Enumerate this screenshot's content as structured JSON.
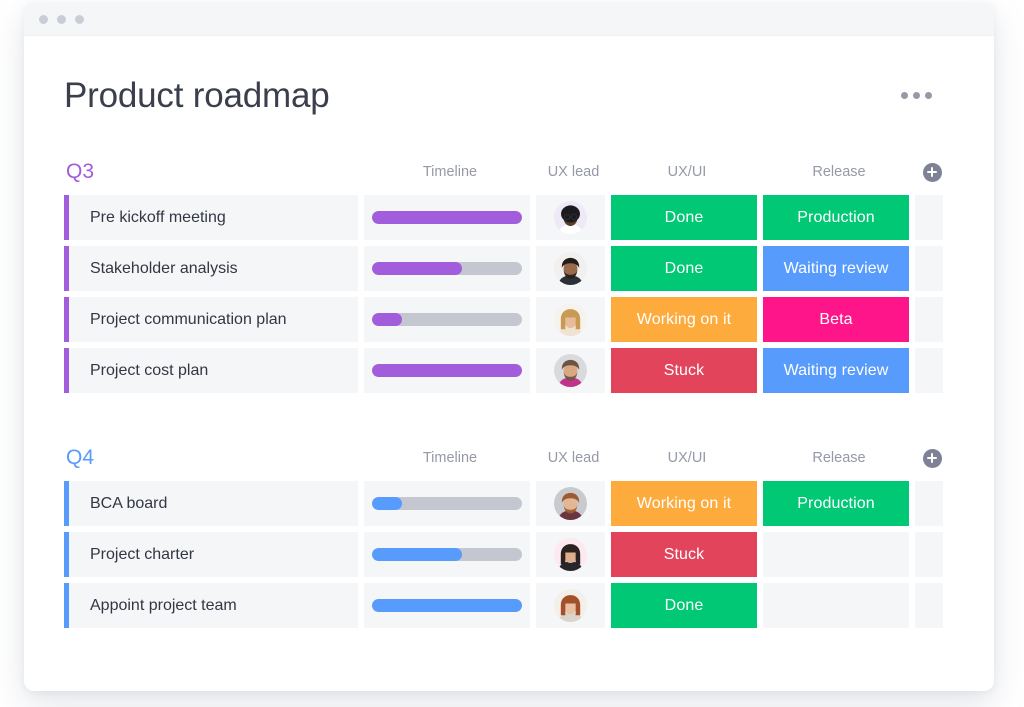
{
  "window": {
    "traffic_lights": [
      "dot-1",
      "dot-2",
      "dot-3"
    ]
  },
  "header": {
    "title": "Product roadmap",
    "menu_icon": "kebab-menu-icon"
  },
  "columns": {
    "name": "",
    "timeline": "Timeline",
    "ux_lead": "UX lead",
    "ux_ui": "UX/UI",
    "release": "Release",
    "add": "add-column-icon"
  },
  "colors": {
    "green": "#00c875",
    "orange": "#fdab3d",
    "red": "#e2445c",
    "blue": "#579bfc",
    "pink": "#ff158a",
    "purple": "#a25ddc",
    "track": "#c5c7d0",
    "cell_bg": "#f5f6f8",
    "text": "#333643",
    "muted": "#9699a6"
  },
  "groups": [
    {
      "title": "Q3",
      "accent": "#a25ddc",
      "rows": [
        {
          "name": "Pre kickoff meeting",
          "timeline_percent": 100,
          "avatar": "avatar-woman-glasses",
          "ux_ui": {
            "label": "Done",
            "color": "#00c875"
          },
          "release": {
            "label": "Production",
            "color": "#00c875"
          }
        },
        {
          "name": "Stakeholder analysis",
          "timeline_percent": 60,
          "avatar": "avatar-man-beard",
          "ux_ui": {
            "label": "Done",
            "color": "#00c875"
          },
          "release": {
            "label": "Waiting review",
            "color": "#579bfc"
          }
        },
        {
          "name": "Project communication plan",
          "timeline_percent": 20,
          "avatar": "avatar-woman-blonde",
          "ux_ui": {
            "label": "Working on it",
            "color": "#fdab3d"
          },
          "release": {
            "label": "Beta",
            "color": "#ff158a"
          }
        },
        {
          "name": "Project cost plan",
          "timeline_percent": 100,
          "avatar": "avatar-man-cap",
          "ux_ui": {
            "label": "Stuck",
            "color": "#e2445c"
          },
          "release": {
            "label": "Waiting review",
            "color": "#579bfc"
          }
        }
      ]
    },
    {
      "title": "Q4",
      "accent": "#579bfc",
      "rows": [
        {
          "name": "BCA board",
          "timeline_percent": 20,
          "avatar": "avatar-man-ginger",
          "ux_ui": {
            "label": "Working on it",
            "color": "#fdab3d"
          },
          "release": {
            "label": "Production",
            "color": "#00c875"
          }
        },
        {
          "name": "Project charter",
          "timeline_percent": 60,
          "avatar": "avatar-woman-dark-hair",
          "ux_ui": {
            "label": "Stuck",
            "color": "#e2445c"
          },
          "release": {
            "label": "",
            "color": ""
          }
        },
        {
          "name": "Appoint project team",
          "timeline_percent": 100,
          "avatar": "avatar-woman-red-hair",
          "ux_ui": {
            "label": "Done",
            "color": "#00c875"
          },
          "release": {
            "label": "",
            "color": ""
          }
        }
      ]
    }
  ]
}
